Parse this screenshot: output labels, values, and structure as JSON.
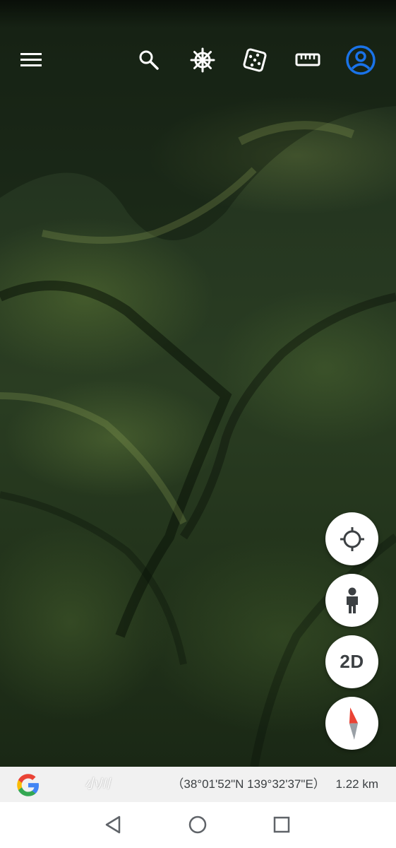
{
  "map": {
    "attribution_text": "小川",
    "coordinates": "（38°01'52\"N 139°32'37\"E）",
    "scale": "1.22 km"
  },
  "toolbar": {
    "items": [
      {
        "icon": "menu-icon"
      },
      {
        "icon": "search-icon"
      },
      {
        "icon": "voyager-wheel-icon"
      },
      {
        "icon": "dice-icon"
      },
      {
        "icon": "ruler-icon"
      },
      {
        "icon": "account-icon"
      }
    ],
    "accent_color": "#1a73e8"
  },
  "controls": {
    "location": "crosshair-icon",
    "street_view": "pegman-icon",
    "view_mode_label": "2D",
    "compass": "compass-icon"
  },
  "navbar": {
    "items": [
      "back-icon",
      "home-icon",
      "recents-icon"
    ]
  }
}
